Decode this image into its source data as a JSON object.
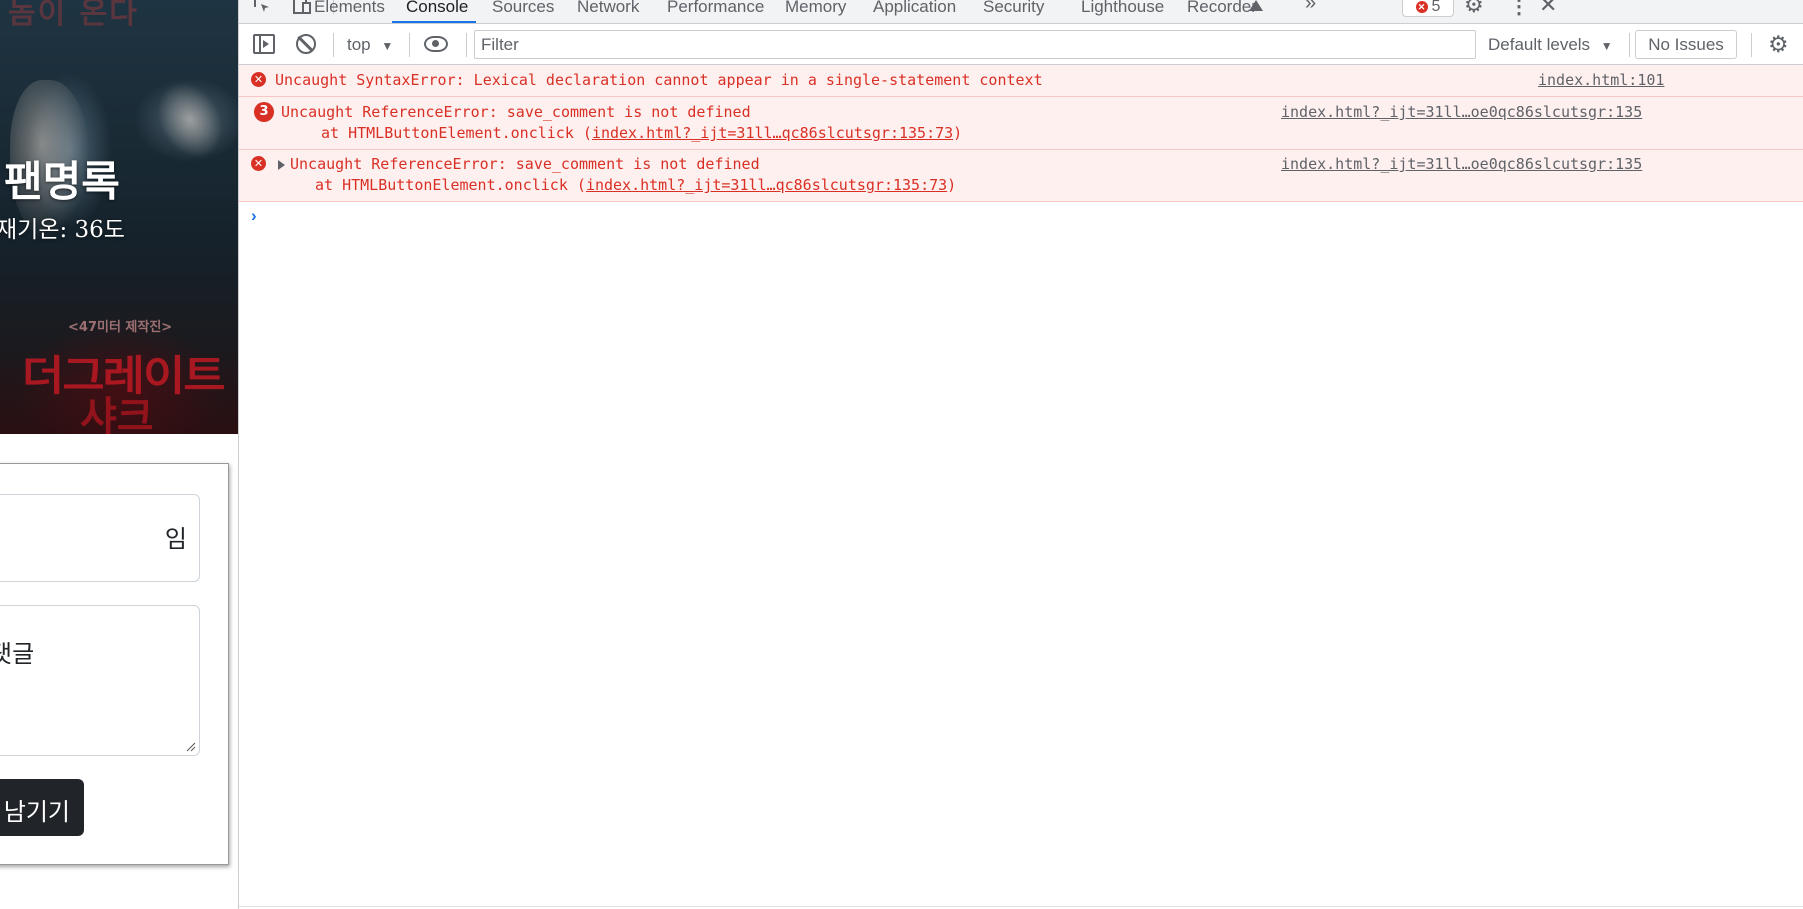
{
  "page": {
    "heading": "팬명록",
    "weather": "재기온: 36도",
    "form": {
      "nickname_value": "임",
      "comment_value": "댓글",
      "submit_label": "남기기"
    },
    "poster": {
      "credit": "<47미터 제작진>",
      "title_line1": "더그레이트",
      "title_line2": "샤크",
      "title_top": "놈이 온다"
    }
  },
  "devtools": {
    "tabs": [
      {
        "label": "Elements"
      },
      {
        "label": "Console"
      },
      {
        "label": "Sources"
      },
      {
        "label": "Network"
      },
      {
        "label": "Performance"
      },
      {
        "label": "Memory"
      },
      {
        "label": "Application"
      },
      {
        "label": "Security"
      },
      {
        "label": "Lighthouse"
      },
      {
        "label": "Recorder"
      }
    ],
    "active_tab": "Console",
    "error_count": "5",
    "toolbar": {
      "context": "top",
      "filter_placeholder": "Filter",
      "levels": "Default levels",
      "issues": "No Issues"
    },
    "messages": [
      {
        "text": "Uncaught SyntaxError: Lexical declaration cannot appear in a single-statement context",
        "source": "index.html:101"
      },
      {
        "count": "3",
        "text": "Uncaught ReferenceError: save_comment is not defined",
        "stack_prefix": "at HTMLButtonElement.onclick (",
        "stack_link": "index.html?_ijt=31ll…qc86slcutsgr:135:73",
        "stack_suffix": ")",
        "source": "index.html?_ijt=31ll…oe0qc86slcutsgr:135"
      },
      {
        "text": "Uncaught ReferenceError: save_comment is not defined",
        "stack_prefix": "at HTMLButtonElement.onclick (",
        "stack_link": "index.html?_ijt=31ll…qc86slcutsgr:135:73",
        "stack_suffix": ")",
        "source": "index.html?_ijt=31ll…oe0qc86slcutsgr:135"
      }
    ],
    "colors": {
      "error": "#d93025",
      "error_bg": "#fff0f0",
      "accent": "#1a73e8"
    }
  }
}
